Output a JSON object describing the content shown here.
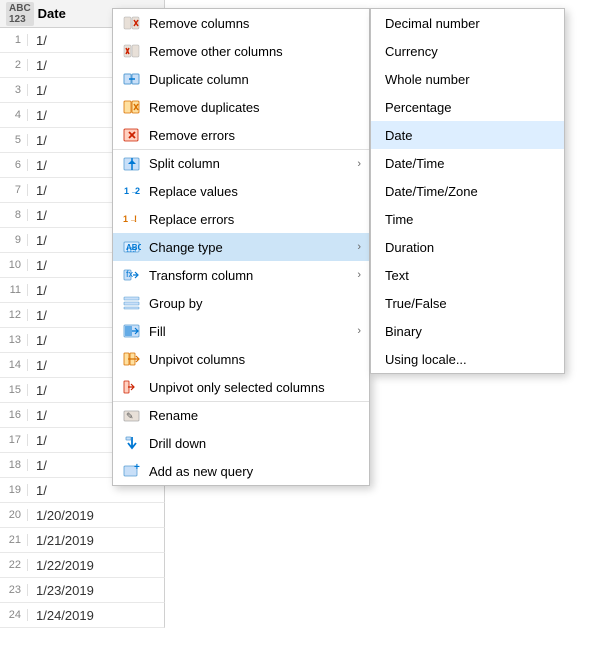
{
  "column": {
    "header": "Date",
    "type_label": "ABC\n123"
  },
  "rows": [
    {
      "num": "1",
      "val": "1/"
    },
    {
      "num": "2",
      "val": "1/"
    },
    {
      "num": "3",
      "val": "1/"
    },
    {
      "num": "4",
      "val": "1/"
    },
    {
      "num": "5",
      "val": "1/"
    },
    {
      "num": "6",
      "val": "1/"
    },
    {
      "num": "7",
      "val": "1/"
    },
    {
      "num": "8",
      "val": "1/"
    },
    {
      "num": "9",
      "val": "1/"
    },
    {
      "num": "10",
      "val": "1/"
    },
    {
      "num": "11",
      "val": "1/"
    },
    {
      "num": "12",
      "val": "1/"
    },
    {
      "num": "13",
      "val": "1/"
    },
    {
      "num": "14",
      "val": "1/"
    },
    {
      "num": "15",
      "val": "1/"
    },
    {
      "num": "16",
      "val": "1/"
    },
    {
      "num": "17",
      "val": "1/"
    },
    {
      "num": "18",
      "val": "1/"
    },
    {
      "num": "19",
      "val": "1/"
    },
    {
      "num": "20",
      "val": "1/20/2019"
    },
    {
      "num": "21",
      "val": "1/21/2019"
    },
    {
      "num": "22",
      "val": "1/22/2019"
    },
    {
      "num": "23",
      "val": "1/23/2019"
    },
    {
      "num": "24",
      "val": "1/24/2019"
    }
  ],
  "context_menu": {
    "items": [
      {
        "id": "remove-columns",
        "label": "Remove columns",
        "icon": "✕",
        "icon_class": "icon-remove-cols",
        "has_arrow": false
      },
      {
        "id": "remove-other-columns",
        "label": "Remove other columns",
        "icon": "✕",
        "icon_class": "icon-remove-cols",
        "has_arrow": false
      },
      {
        "id": "duplicate-column",
        "label": "Duplicate column",
        "icon": "⧉",
        "icon_class": "icon-blue",
        "has_arrow": false
      },
      {
        "id": "remove-duplicates",
        "label": "Remove duplicates",
        "icon": "≡",
        "icon_class": "icon-orange",
        "has_arrow": false
      },
      {
        "id": "remove-errors",
        "label": "Remove errors",
        "icon": "⚑",
        "icon_class": "icon-red",
        "has_arrow": false
      },
      {
        "id": "split-column",
        "label": "Split column",
        "icon": "⬡",
        "icon_class": "icon-blue",
        "has_arrow": true,
        "separator": true
      },
      {
        "id": "replace-values",
        "label": "Replace values",
        "icon": "↔",
        "icon_class": "icon-blue",
        "has_arrow": false
      },
      {
        "id": "replace-errors",
        "label": "Replace errors",
        "icon": "↔",
        "icon_class": "icon-orange",
        "has_arrow": false
      },
      {
        "id": "change-type",
        "label": "Change type",
        "icon": "⬡",
        "icon_class": "icon-blue",
        "has_arrow": true,
        "highlighted": true
      },
      {
        "id": "transform-column",
        "label": "Transform column",
        "icon": "⬡",
        "icon_class": "icon-blue",
        "has_arrow": true
      },
      {
        "id": "group-by",
        "label": "Group by",
        "icon": "▤",
        "icon_class": "icon-blue",
        "has_arrow": false
      },
      {
        "id": "fill",
        "label": "Fill",
        "icon": "▥",
        "icon_class": "icon-blue",
        "has_arrow": true
      },
      {
        "id": "unpivot-columns",
        "label": "Unpivot columns",
        "icon": "⬡",
        "icon_class": "icon-blue",
        "has_arrow": false
      },
      {
        "id": "unpivot-selected",
        "label": "Unpivot only selected columns",
        "icon": "⬡",
        "icon_class": "icon-blue",
        "has_arrow": false
      },
      {
        "id": "rename",
        "label": "Rename",
        "icon": "✎",
        "icon_class": "icon-generic",
        "has_arrow": false,
        "separator": true
      },
      {
        "id": "drill-down",
        "label": "Drill down",
        "icon": "↓",
        "icon_class": "icon-blue",
        "has_arrow": false
      },
      {
        "id": "add-new-query",
        "label": "Add as new query",
        "icon": "⬡",
        "icon_class": "icon-blue",
        "has_arrow": false
      }
    ]
  },
  "submenu": {
    "items": [
      {
        "id": "decimal-number",
        "label": "Decimal number",
        "active": false
      },
      {
        "id": "currency",
        "label": "Currency",
        "active": false
      },
      {
        "id": "whole-number",
        "label": "Whole number",
        "active": false
      },
      {
        "id": "percentage",
        "label": "Percentage",
        "active": false
      },
      {
        "id": "date",
        "label": "Date",
        "active": true
      },
      {
        "id": "date-time",
        "label": "Date/Time",
        "active": false
      },
      {
        "id": "date-time-zone",
        "label": "Date/Time/Zone",
        "active": false
      },
      {
        "id": "time",
        "label": "Time",
        "active": false
      },
      {
        "id": "duration",
        "label": "Duration",
        "active": false
      },
      {
        "id": "text",
        "label": "Text",
        "active": false
      },
      {
        "id": "true-false",
        "label": "True/False",
        "active": false
      },
      {
        "id": "binary",
        "label": "Binary",
        "active": false
      },
      {
        "id": "using-locale",
        "label": "Using locale...",
        "active": false
      }
    ]
  }
}
